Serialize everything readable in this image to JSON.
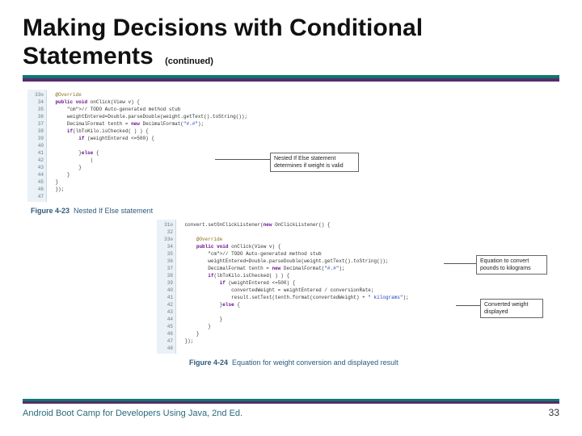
{
  "title_line1": "Making Decisions with Conditional",
  "title_line2": "Statements",
  "continued": "(continued)",
  "footer": {
    "book": "Android Boot Camp for Developers Using Java, 2nd Ed.",
    "page": "33"
  },
  "fig1": {
    "caption_no": "Figure 4-23",
    "caption_text": "Nested If Else statement",
    "callout": "Nested If Else statement determines if weight is valid",
    "gutter": [
      "33⊖",
      "34",
      "35",
      "36",
      "37",
      "38",
      "39",
      "40",
      "41",
      "42",
      "43",
      "44",
      "45",
      "46",
      "47"
    ],
    "code": [
      "@Override",
      "public void onClick(View v) {",
      "    // TODO Auto-generated method stub",
      "    weightEntered=Double.parseDouble(weight.getText().toString());",
      "    DecimalFormat tenth = new DecimalFormat(\"#.#\");",
      "    if(lbToKilo.isChecked( ) ) {",
      "        if (weightEntered <=500) {",
      "",
      "        }else {",
      "            |",
      "        }",
      "    }",
      "}",
      "});",
      ""
    ]
  },
  "fig2": {
    "caption_no": "Figure 4-24",
    "caption_text": "Equation for weight conversion and displayed result",
    "callout1": "Equation to convert pounds to kilograms",
    "callout2": "Converted weight displayed",
    "gutter": [
      "31⊖",
      "32",
      "33⊖",
      "34",
      "35",
      "36",
      "37",
      "38",
      "39",
      "40",
      "41",
      "42",
      "43",
      "44",
      "45",
      "46",
      "47",
      "48"
    ],
    "code": [
      "convert.setOnClickListener(new OnClickListener() {",
      "",
      "    @Override",
      "    public void onClick(View v) {",
      "        // TODO Auto-generated method stub",
      "        weightEntered=Double.parseDouble(weight.getText().toString());",
      "        DecimalFormat tenth = new DecimalFormat(\"#.#\");",
      "        if(lbToKilo.isChecked( ) ) {",
      "            if (weightEntered <=500) {",
      "                convertedWeight = weightEntered / conversionRate;",
      "                result.setText(tenth.format(convertedWeight) + \" kilograms\");",
      "            }else {",
      "",
      "            }",
      "        }",
      "    }",
      "});",
      ""
    ]
  }
}
